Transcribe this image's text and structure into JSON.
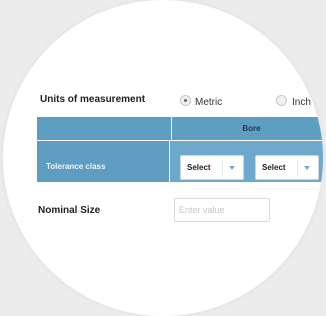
{
  "units": {
    "label": "Units of measurement",
    "options": [
      {
        "label": "Metric",
        "selected": true
      },
      {
        "label": "Inch",
        "selected": false
      }
    ]
  },
  "table": {
    "header": "Bore",
    "row_label": "Tolerance class",
    "selects": [
      {
        "value": "Select"
      },
      {
        "value": "Select"
      }
    ]
  },
  "nominal": {
    "label": "Nominal Size",
    "placeholder": "Enter value"
  },
  "colors": {
    "header_bg": "#5f9ec3",
    "row_bg": "#6ea8cc"
  }
}
